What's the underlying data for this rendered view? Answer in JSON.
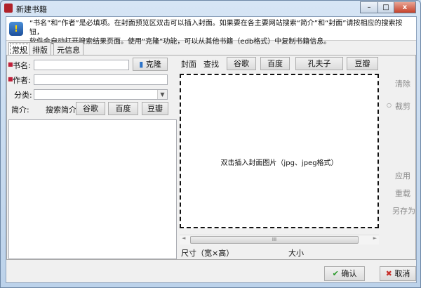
{
  "window": {
    "title": "新建书籍",
    "minimize": "–",
    "maximize": "□",
    "close": "x"
  },
  "info": {
    "line1": "“书名”和“作者”是必填项。在封面预览区双击可以插入封面。如果要在各主要网站搜索“简介”和“封面”请按相应的搜索按钮，",
    "line2": "软件会自动打开搜索结果页面。使用“克隆”功能，可以从其他书籍（edb格式）中复制书籍信息。"
  },
  "tabs": [
    {
      "label": "常规",
      "active": true
    },
    {
      "label": "排版"
    },
    {
      "label": "元信息"
    }
  ],
  "form": {
    "title_label": "书名:",
    "author_label": "作者:",
    "category_label": "分类:",
    "summary_label": "简介:",
    "search_summary_label": "搜索简介",
    "clone_button": "克隆",
    "title_value": "",
    "author_value": "",
    "category_value": "",
    "summary_value": ""
  },
  "summary_search": [
    "谷歌",
    "百度",
    "豆瓣"
  ],
  "cover": {
    "label": "封面",
    "find_label": "查找",
    "search_buttons": [
      "谷歌",
      "百度",
      "孔夫子",
      "豆瓣"
    ],
    "placeholder": "双击插入封面图片（jpg、jpeg格式）",
    "size_label": "尺寸（宽×高）",
    "filesize_label": "大小",
    "scroll_thumb": "III"
  },
  "side": {
    "clear": "清除",
    "crop": "裁剪",
    "apply": "应用",
    "reload": "重载",
    "save_as": "另存为"
  },
  "footer": {
    "ok": "确认",
    "cancel": "取消"
  }
}
